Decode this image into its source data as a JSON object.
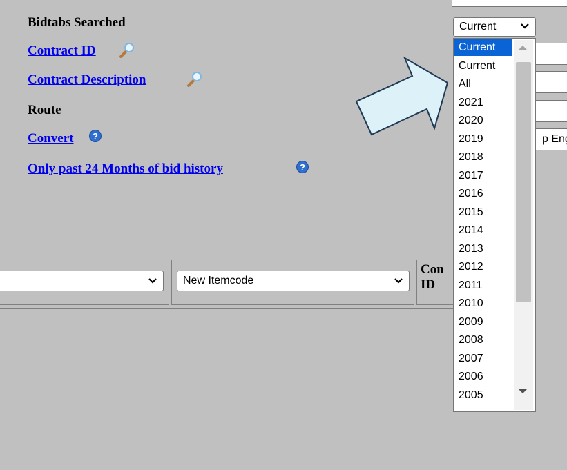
{
  "labels": {
    "bidtabs_searched": "Bidtabs Searched",
    "contract_id": "Contract ID",
    "contract_description": "Contract Description",
    "route": "Route",
    "convert": "Convert",
    "past_24_months": "Only past 24 Months of bid history "
  },
  "year_select": {
    "selected": "Current",
    "options": [
      "Current",
      "Current",
      "All",
      "2021",
      "2020",
      "2019",
      "2018",
      "2017",
      "2016",
      "2015",
      "2014",
      "2013",
      "2012",
      "2011",
      "2010",
      "2009",
      "2008",
      "2007",
      "2006",
      "2005"
    ]
  },
  "partial_field_text": "p Eng",
  "filters": {
    "itemcode_select": "New Itemcode",
    "contract_col_line1": "Con",
    "contract_col_line2": "ID"
  },
  "icons": {
    "magnifier": "magnifier-icon",
    "help": "help-icon",
    "help_glyph": "?",
    "chevron": "chevron-down-icon",
    "annotation_arrow": "arrow-annotation"
  },
  "colors": {
    "background": "#c0c0c0",
    "link": "#0000ee",
    "selection": "#0a64d6",
    "arrow_fill": "#ddf1f8",
    "arrow_stroke": "#1f3a54"
  }
}
